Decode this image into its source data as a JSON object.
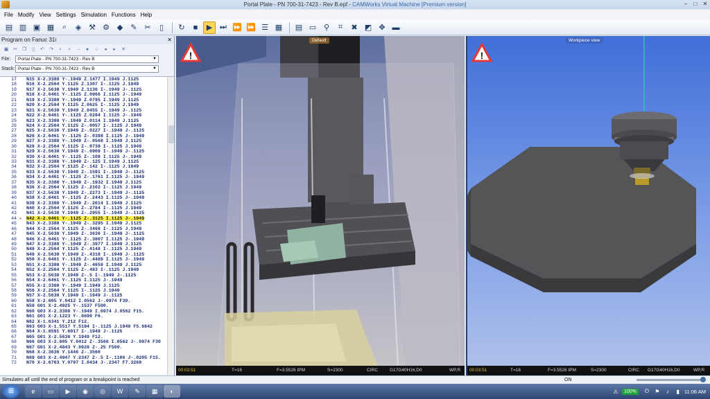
{
  "window": {
    "title": "Portal Plate - PN 700-31-7423 - Rev B.epf - ",
    "app_name": "CAMWorks Virtual Machine [Premium version]",
    "controls": [
      "–",
      "□",
      "✕"
    ]
  },
  "menu": [
    "File",
    "Modify",
    "View",
    "Settings",
    "Simulation",
    "Functions",
    "Help"
  ],
  "toolbar": {
    "icons": [
      "open-folder-icon",
      "open-file-icon",
      "save-icon",
      "print-icon",
      "zoom-icon",
      "layers-icon",
      "tool-icon",
      "machine-icon",
      "workpiece-icon",
      "wrench-icon",
      "cross-tools-icon",
      "clipboard-icon",
      "reset-icon",
      "stop-icon",
      "play-icon",
      "step-icon",
      "fast-forward-icon",
      "end-icon",
      "list-icon",
      "grid-icon",
      "report-icon",
      "monitor-icon",
      "measure-icon",
      "crop-icon",
      "delete-icon",
      "box-icon",
      "move-icon",
      "screen-icon"
    ]
  },
  "left_panel": {
    "title": "Program on Fanuc 31i",
    "file_label": "File:",
    "file_value": "Portal Plate - PN 700-31-7423 - Rev B",
    "stack_label": "Stack:",
    "stack_value": "Portal Plate - PN 700-31-7423 - Rev B",
    "highlight_line": 44,
    "lines": [
      {
        "n": "17",
        "code": "N15 X-2.3388 Y-.1949 Z.1477 I.1949 J.1125"
      },
      {
        "n": "18",
        "code": "N16 X-2.2564 Y.1125 Z.1307 I-.1125 J.1949"
      },
      {
        "n": "19",
        "code": "N17 X-2.5638 Y.1949 Z.1136 I-.1949 J-.1125"
      },
      {
        "n": "20",
        "code": "N18 X-2.6461 Y-.1125 Z.0966 I.1125 J-.1949"
      },
      {
        "n": "21",
        "code": "N19 X-2.3388 Y-.1949 Z.0795 I.1949 J.1125"
      },
      {
        "n": "22",
        "code": "N20 X-2.2564 Y.1125 Z.0625 I-.1125 J.1949"
      },
      {
        "n": "23",
        "code": "N21 X-2.5638 Y.1949 Z.0455 I-.1949 J-.1125"
      },
      {
        "n": "24",
        "code": "N22 X-2.6461 Y-.1125 Z.0284 I.1125 J-.1949"
      },
      {
        "n": "25",
        "code": "N23 X-2.3388 Y-.1949 Z.0114 I.1949 J.1125"
      },
      {
        "n": "26",
        "code": "N24 X-2.2564 Y.1125 Z-.0057 I-.1125 J.1949"
      },
      {
        "n": "27",
        "code": "N25 X-2.5638 Y.1949 Z-.0227 I-.1949 J-.1125"
      },
      {
        "n": "28",
        "code": "N26 X-2.6461 Y-.1125 Z-.0398 I.1125 J-.1949"
      },
      {
        "n": "29",
        "code": "N27 X-2.3388 Y-.1949 Z-.0568 I.1949 J.1125"
      },
      {
        "n": "30",
        "code": "N28 X-2.2564 Y.1125 Z-.0739 I-.1125 J.1949"
      },
      {
        "n": "31",
        "code": "N29 X-2.5638 Y.1949 Z-.0909 I-.1949 J-.1125"
      },
      {
        "n": "32",
        "code": "N30 X-2.6461 Y-.1125 Z-.108 I.1125 J-.1949"
      },
      {
        "n": "33",
        "code": "N31 X-2.3388 Y-.1949 Z-.125 I.1949 J.1125"
      },
      {
        "n": "34",
        "code": "N32 X-2.2564 Y.1125 Z-.142 I-.1125 J.1949"
      },
      {
        "n": "35",
        "code": "N33 X-2.5638 Y.1949 Z-.1591 I-.1949 J-.1125"
      },
      {
        "n": "36",
        "code": "N34 X-2.6461 Y-.1125 Z-.1761 I.1125 J-.1949"
      },
      {
        "n": "37",
        "code": "N35 X-2.3388 Y-.1949 Z-.1932 I.1949 J.1125"
      },
      {
        "n": "38",
        "code": "N36 X-2.2564 Y.1125 Z-.2102 I-.1125 J.1949"
      },
      {
        "n": "39",
        "code": "N37 X-2.5638 Y.1949 Z-.2273 I-.1949 J-.1125"
      },
      {
        "n": "40",
        "code": "N38 X-2.6461 Y-.1125 Z-.2443 I.1125 J-.1949"
      },
      {
        "n": "41",
        "code": "N39 X-2.3388 Y-.1949 Z-.2614 I.1949 J.1125"
      },
      {
        "n": "42",
        "code": "N40 X-2.2564 Y.1125 Z-.2784 I-.1125 J.1949"
      },
      {
        "n": "43",
        "code": "N41 X-2.5638 Y.1949 Z-.2955 I-.1949 J-.1125"
      },
      {
        "n": "44",
        "code": "N42 X-2.6461 Y-.1125 Z-.3125 I.1125 J-.1949"
      },
      {
        "n": "45",
        "code": "N43 X-2.3388 Y-.1949 Z-.3295 I.1949 J.1125"
      },
      {
        "n": "46",
        "code": "N44 X-2.2564 Y.1125 Z-.3466 I-.1125 J.1949"
      },
      {
        "n": "47",
        "code": "N45 X-2.5638 Y.1949 Z-.3636 I-.1949 J-.1125"
      },
      {
        "n": "48",
        "code": "N46 X-2.6461 Y-.1125 Z-.3807 I.1125 J-.1949"
      },
      {
        "n": "49",
        "code": "N47 X-2.3388 Y-.1949 Z-.3977 I.1949 J.1125"
      },
      {
        "n": "50",
        "code": "N48 X-2.2564 Y.1125 Z-.4148 I-.1125 J.1949"
      },
      {
        "n": "51",
        "code": "N49 X-2.5638 Y.1949 Z-.4318 I-.1949 J-.1125"
      },
      {
        "n": "52",
        "code": "N50 X-2.6461 Y-.1125 Z-.4489 I.1125 J-.1949"
      },
      {
        "n": "53",
        "code": "N51 X-2.3388 Y-.1949 Z-.4659 I.1949 J.1125"
      },
      {
        "n": "54",
        "code": "N52 X-2.2564 Y.1125 Z-.483 I-.1125 J.1949"
      },
      {
        "n": "55",
        "code": "N53 X-2.5638 Y.1949 Z-.5 I-.1949 J-.1125"
      },
      {
        "n": "56",
        "code": "N54 X-2.6461 Y-.1125 I.1125 J-.1949"
      },
      {
        "n": "57",
        "code": "N55 X-2.3388 Y-.1949 I.1949 J.1125"
      },
      {
        "n": "58",
        "code": "N56 X-2.2564 Y.1125 I-.1125 J.1949"
      },
      {
        "n": "59",
        "code": "N57 X-2.5638 Y.1949 I-.1949 J-.1125"
      },
      {
        "n": "60",
        "code": "N58 X-2.605 Y.0412 I.0562 J-.0974 F30."
      },
      {
        "n": "61",
        "code": "N59 G01 X-2.4925 Y-.1537 F500."
      },
      {
        "n": "62",
        "code": "N60 G03 X-2.3388 Y-.1949 I.0974 J.0562 F15."
      },
      {
        "n": "63",
        "code": "N61 G01 X-2.1223 Y-.0699 F6."
      },
      {
        "n": "64",
        "code": "N62 X-1.6341 Y.212 F12."
      },
      {
        "n": "65",
        "code": "N63 G03 X-1.5517 Y.5194 I-.1125 J.1949 F5.6842"
      },
      {
        "n": "66",
        "code": "N64 X-1.8591 Y.6017 I-.1949 J-.1125"
      },
      {
        "n": "67",
        "code": "N65 G01 X-2.5638 Y.1949 F12."
      },
      {
        "n": "68",
        "code": "N66 G03 X-2.605 Y.0412 Z-.3566 I.0562 J-.0974 F30"
      },
      {
        "n": "69",
        "code": "N67 G01 X-2.4843 Y.0928 Z-.25 F500."
      },
      {
        "n": "70",
        "code": "N68 X-2.3636 Y.1446 Z-.3566"
      },
      {
        "n": "71",
        "code": "N69 G03 X-2.4947 Y.2347 Z-.5 I-.1106 J-.0205 F15."
      },
      {
        "n": "72",
        "code": "N70 X-2.6763 Y.0797 I.0434 J-.2347 F7.3268"
      }
    ]
  },
  "viewport_left": {
    "label": "Default",
    "status": {
      "time": "00:03:51",
      "tool": "T=16",
      "feed": "F=3.5526 IPM",
      "speed": "S=2300",
      "mode": "CIRC",
      "codes": "G17G40H16,D0",
      "wp": "WP,R"
    }
  },
  "viewport_right": {
    "label": "Workpiece view",
    "status": {
      "time": "00:03:51",
      "tool": "T=16",
      "feed": "F=3.5526 IPM",
      "speed": "S=2300",
      "mode": "CIRC",
      "codes": "G17G40H16,D0",
      "wp": "WP,R"
    }
  },
  "statusbar": {
    "text": "Simulates all until the end of program or a breakpoint is reached",
    "mode": "ON"
  },
  "taskbar": {
    "apps": [
      "ie-icon",
      "folder-icon",
      "media-icon",
      "red-app-icon",
      "chrome-icon",
      "word-icon",
      "paint-icon",
      "app-icon",
      "camworks-icon"
    ],
    "battery": "100%",
    "time": "11:06 AM"
  },
  "colors": {
    "highlight": "#fff34a",
    "accent": "#3b66a8",
    "warning": "#e53935"
  }
}
